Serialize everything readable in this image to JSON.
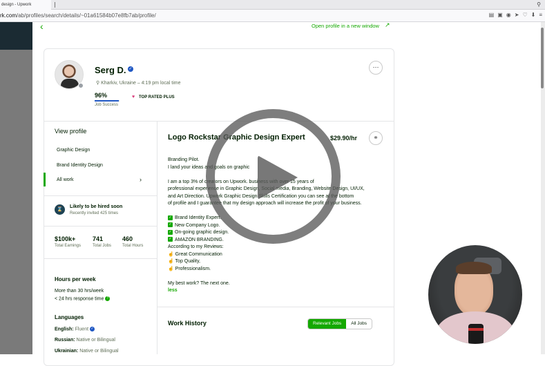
{
  "browser": {
    "tab_title": "design - Upwork",
    "url_host_part": "rk.com",
    "url_path": "/ab/profiles/search/details/~01a61584b07e8fb7ab/profile/"
  },
  "header": {
    "back_icon": "chevron-left-icon",
    "open_profile_label": "Open profile in a new window"
  },
  "profile": {
    "name": "Serg D.",
    "location": "Kharkiv, Ukraine – 4:19 pm local time",
    "job_success_value": "96%",
    "job_success_fraction": 0.96,
    "job_success_label": "Job Success",
    "badge": "TOP RATED PLUS"
  },
  "sidebar": {
    "title": "View profile",
    "items": [
      {
        "label": "Graphic Design"
      },
      {
        "label": "Brand Identity Design"
      },
      {
        "label": "All work"
      }
    ],
    "hire_title": "Likely to be hired soon",
    "hire_sub": "Recently invited 425 times",
    "stats": [
      {
        "value": "$100k+",
        "label": "Total Earnings"
      },
      {
        "value": "741",
        "label": "Total Jobs"
      },
      {
        "value": "460",
        "label": "Total Hours"
      }
    ],
    "hours_title": "Hours per week",
    "hours_line1": "More than 30 hrs/week",
    "hours_line2": "< 24 hrs response time",
    "languages_title": "Languages",
    "languages": [
      {
        "name": "English:",
        "level": "Fluent"
      },
      {
        "name": "Russian:",
        "level": "Native or Bilingual"
      },
      {
        "name": "Ukrainian:",
        "level": "Native or Bilingual"
      }
    ]
  },
  "main": {
    "title": "Logo Rockstar Graphic Design Expert",
    "rate": "$29.90/hr",
    "desc": {
      "l1": "Branding Pilot.",
      "l2": "I land your ideas and goals on graphic",
      "l3": "I am a top 3% of creators on Upwork. business with over 15 years of",
      "l4": "professional experience in Graphic Design, Social media, Branding, Website Design, UI/UX,",
      "l5": "and Art Direction. Upwork Graphic Design Skills Certification you can see at the bottom",
      "l6": "of profile and I guarantee that my design approach will increase the profit of your business.",
      "c1": "Brand Identity Expert.",
      "c2": "New Company Logo.",
      "c3": "On-going graphic design.",
      "c4": "AMAZON BRANDING.",
      "r0": "According to my Reviews:",
      "r1": "Great Communication",
      "r2": "Top Quality,",
      "r3": "Professionalism.",
      "best": "My best work? The next one.",
      "less": "less"
    },
    "work_history_title": "Work History",
    "tabs": [
      "Relevant Jobs",
      "All Jobs"
    ]
  },
  "overlay": {
    "play_icon": "play-button-icon",
    "webcam": "presenter-webcam"
  },
  "colors": {
    "brand_green": "#14a800",
    "verified_blue": "#1f57c3",
    "text_dark": "#001e00"
  }
}
